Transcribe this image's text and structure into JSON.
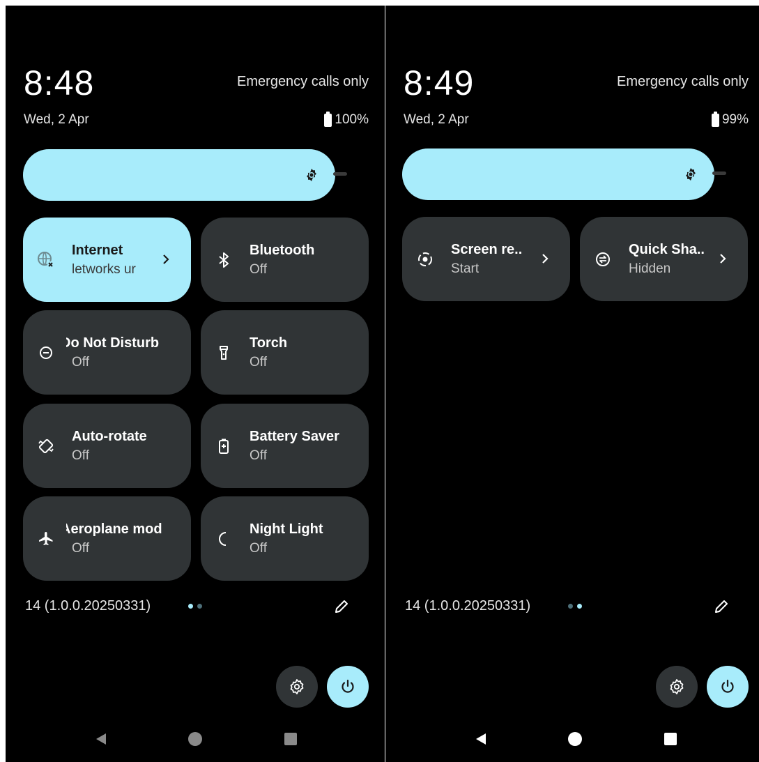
{
  "colors": {
    "accent": "#a8ecfb",
    "tile_bg": "#303436",
    "panel_bg": "#000000"
  },
  "left": {
    "clock": "8:48",
    "carrier": "Emergency calls only",
    "date": "Wed, 2 Apr",
    "battery": "100%",
    "tiles": [
      {
        "label": "Internet",
        "sub": "letworks ur",
        "icon": "internet-no-network-icon",
        "active": true,
        "chevron": true
      },
      {
        "label": "Bluetooth",
        "sub": "Off",
        "icon": "bluetooth-icon"
      },
      {
        "label": "Do Not Disturb",
        "sub": "Off",
        "icon": "do-not-disturb-icon"
      },
      {
        "label": "Torch",
        "sub": "Off",
        "icon": "torch-icon"
      },
      {
        "label": "Auto-rotate",
        "sub": "Off",
        "icon": "auto-rotate-icon"
      },
      {
        "label": "Battery Saver",
        "sub": "Off",
        "icon": "battery-saver-icon"
      },
      {
        "label": "Aeroplane mod",
        "sub": "Off",
        "icon": "airplane-icon"
      },
      {
        "label": "Night Light",
        "sub": "Off",
        "icon": "night-light-icon"
      }
    ],
    "build": "14 (1.0.0.20250331)",
    "page_index": 0
  },
  "right": {
    "clock": "8:49",
    "carrier": "Emergency calls only",
    "date": "Wed, 2 Apr",
    "battery": "99%",
    "tiles": [
      {
        "label": "Screen re..",
        "sub": "Start",
        "icon": "screen-record-icon",
        "chevron": true
      },
      {
        "label": "Quick Sha..",
        "sub": "Hidden",
        "icon": "quick-share-icon",
        "chevron": true
      }
    ],
    "build": "14 (1.0.0.20250331)",
    "page_index": 1
  }
}
